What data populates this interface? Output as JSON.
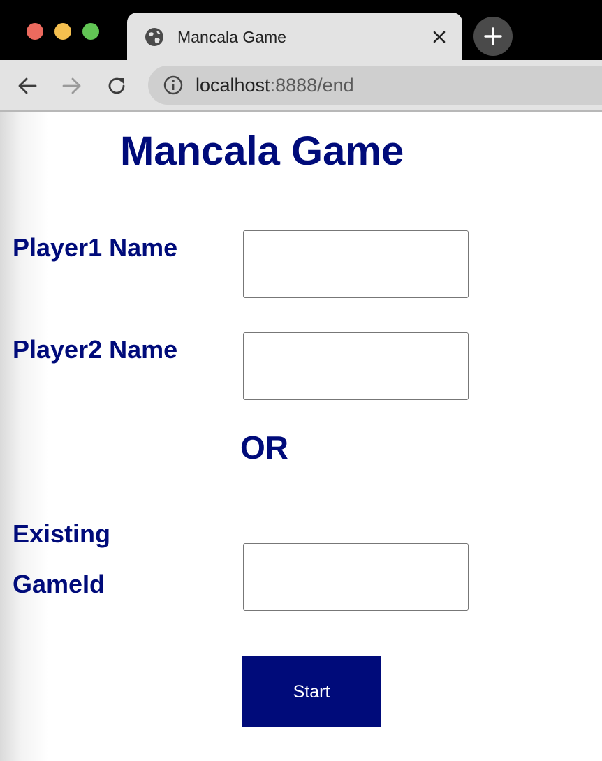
{
  "browser": {
    "tab_title": "Mancala Game",
    "url_host": "localhost",
    "url_path": ":8888/end",
    "icons": {
      "tab_favicon": "globe-icon",
      "tab_close": "close-icon",
      "new_tab": "plus-icon",
      "back": "arrow-left-icon",
      "forward": "arrow-right-icon",
      "reload": "reload-icon",
      "site_info": "info-icon"
    },
    "colors": {
      "traffic_red": "#ec6a5e",
      "traffic_yellow": "#f4bf4f",
      "traffic_green": "#61c554"
    }
  },
  "page": {
    "title": "Mancala Game",
    "player1_label": "Player1 Name",
    "player1_value": "",
    "player2_label": "Player2 Name",
    "player2_value": "",
    "or_text": "OR",
    "existing_label_line1": "Existing",
    "existing_label_line2": "GameId",
    "game_id_value": "",
    "start_label": "Start",
    "colors": {
      "accent": "#000b7a",
      "button_text": "#ffffff"
    }
  }
}
